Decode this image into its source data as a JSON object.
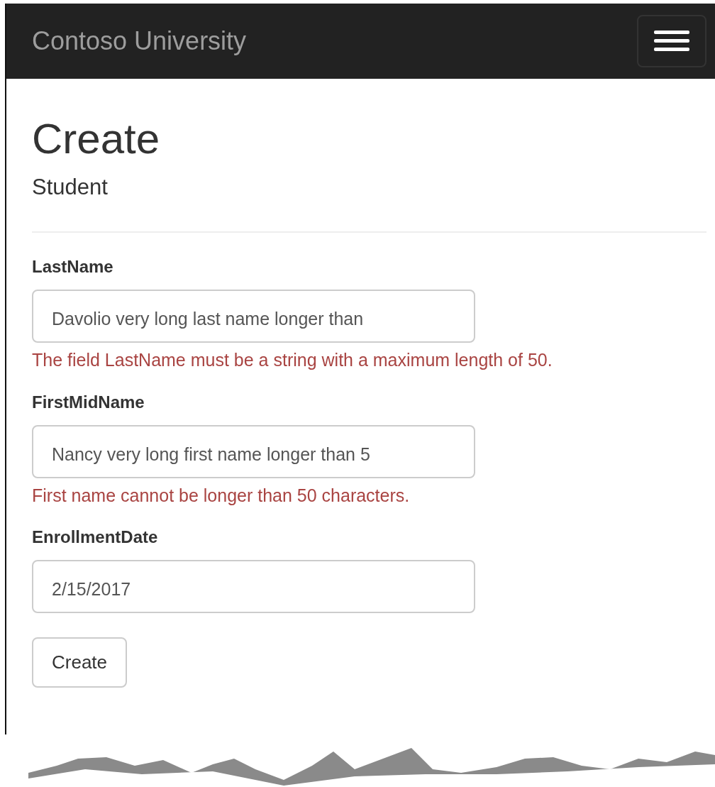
{
  "navbar": {
    "brand": "Contoso University"
  },
  "heading": "Create",
  "subheading": "Student",
  "fields": [
    {
      "label": "LastName",
      "value": "Davolio very long last name longer than",
      "error": "The field LastName must be a string with a maximum length of 50."
    },
    {
      "label": "FirstMidName",
      "value": "Nancy very long first name longer than 5",
      "error": "First name cannot be longer than 50 characters."
    },
    {
      "label": "EnrollmentDate",
      "value": "2/15/2017"
    }
  ],
  "submit": "Create"
}
